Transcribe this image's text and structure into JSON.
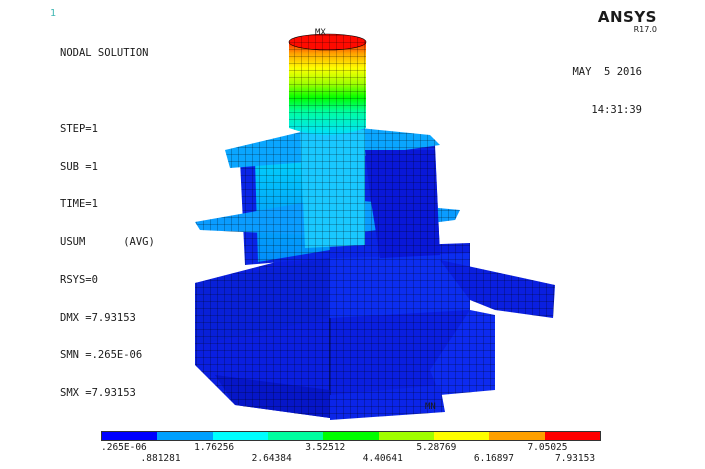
{
  "window_number": "1",
  "brand": {
    "name": "ANSYS",
    "version": "R17.0"
  },
  "info_lines": [
    "NODAL SOLUTION",
    "",
    "STEP=1",
    "SUB =1",
    "TIME=1",
    "USUM      (AVG)",
    "RSYS=0",
    "DMX =7.93153",
    "SMN =.265E-06",
    "SMX =7.93153"
  ],
  "date": "MAY  5 2016",
  "time": "14:31:39",
  "markers": {
    "max": "MX",
    "min": "MN"
  },
  "legend": {
    "colors": [
      "#0000ff",
      "#00a0ff",
      "#00ffff",
      "#00ffa0",
      "#00ff00",
      "#a0ff00",
      "#ffff00",
      "#ffa000",
      "#ff0000"
    ],
    "upper_labels": [
      ".265E-06",
      "1.76256",
      "3.52512",
      "5.28769",
      "7.05025"
    ],
    "lower_labels": [
      ".881281",
      "2.64384",
      "4.40641",
      "6.16897",
      "7.93153"
    ]
  }
}
